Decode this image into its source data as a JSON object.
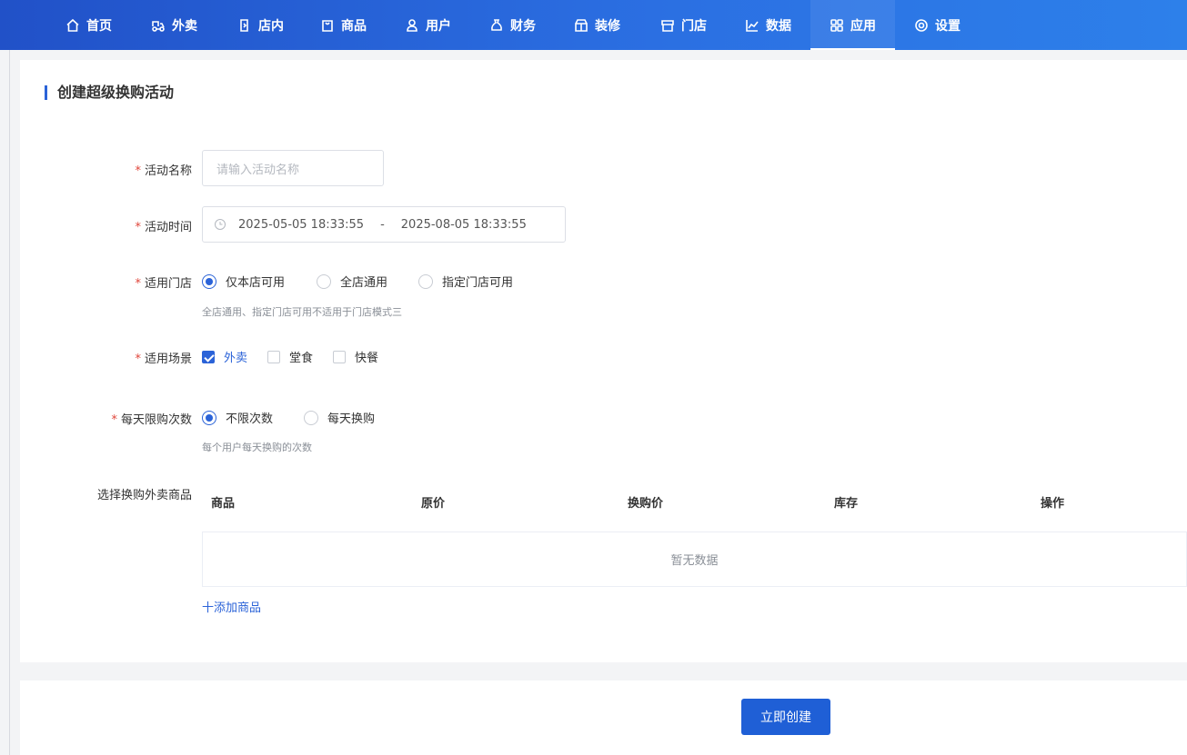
{
  "nav": {
    "items": [
      {
        "label": "首页",
        "icon": "home-icon"
      },
      {
        "label": "外卖",
        "icon": "delivery-icon"
      },
      {
        "label": "店内",
        "icon": "dine-in-icon"
      },
      {
        "label": "商品",
        "icon": "bag-icon"
      },
      {
        "label": "用户",
        "icon": "user-icon"
      },
      {
        "label": "财务",
        "icon": "money-bag-icon"
      },
      {
        "label": "装修",
        "icon": "decorate-icon"
      },
      {
        "label": "门店",
        "icon": "store-icon"
      },
      {
        "label": "数据",
        "icon": "chart-icon"
      },
      {
        "label": "应用",
        "icon": "apps-icon"
      },
      {
        "label": "设置",
        "icon": "gear-icon"
      }
    ],
    "active": "应用"
  },
  "form": {
    "title": "创建超级换购活动",
    "name": {
      "label": "活动名称",
      "placeholder": "请输入活动名称"
    },
    "time": {
      "label": "活动时间",
      "start": "2025-05-05 18:33:55",
      "separator": "-",
      "end": "2025-08-05 18:33:55"
    },
    "store": {
      "label": "适用门店",
      "options": [
        "仅本店可用",
        "全店通用",
        "指定门店可用"
      ],
      "selected": "仅本店可用",
      "hint": "全店通用、指定门店可用不适用于门店模式三"
    },
    "scene": {
      "label": "适用场景",
      "options": [
        "外卖",
        "堂食",
        "快餐"
      ],
      "checked": [
        "外卖"
      ]
    },
    "limit": {
      "label": "每天限购次数",
      "options": [
        "不限次数",
        "每天换购"
      ],
      "selected": "不限次数",
      "hint": "每个用户每天换购的次数"
    },
    "goods": {
      "label": "选择换购外卖商品",
      "columns": [
        "商品",
        "原价",
        "换购价",
        "库存",
        "操作"
      ],
      "empty_text": "暂无数据",
      "add_label": "十添加商品"
    },
    "required_mark": "*"
  },
  "actions": {
    "submit_label": "立即创建"
  },
  "colors": {
    "primary": "#1f5fd6",
    "required": "#e0463b",
    "nav_start": "#2151c8",
    "nav_end": "#2d80ea"
  }
}
